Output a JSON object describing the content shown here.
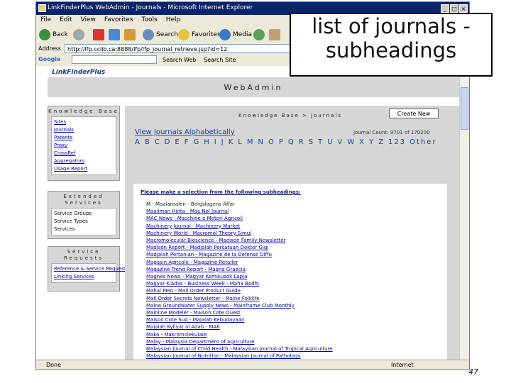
{
  "window": {
    "title": "LinkFinderPlus WebAdmin - Journals - Microsoft Internet Explorer",
    "menu": [
      "File",
      "Edit",
      "View",
      "Favorites",
      "Tools",
      "Help"
    ]
  },
  "toolbar": {
    "back": "Back",
    "search": "Search",
    "favorites": "Favorites",
    "media": "Media"
  },
  "address": {
    "label": "Address",
    "url": "http://lfp.cclib.ca:8888/lfp/lfp_journal_retrieve.jsp?id=12"
  },
  "google": {
    "logo": "Google",
    "search_web": "Search Web",
    "search_site": "Search Site"
  },
  "status": {
    "left": "Done",
    "right": "Internet"
  },
  "page": {
    "logo": "LinkFinderPlus",
    "banner": "WebAdmin",
    "breadcrumb": "Knowledge Base > Journals",
    "create_button": "Create New",
    "view_link": "View Journals Alphabetically",
    "journal_count": "Journal Count: 9701 of 170200",
    "letters": [
      "A",
      "B",
      "C",
      "D",
      "E",
      "F",
      "G",
      "H",
      "I",
      "J",
      "K",
      "L",
      "M",
      "N",
      "O",
      "P",
      "Q",
      "R",
      "S",
      "T",
      "U",
      "V",
      "W",
      "X",
      "Y",
      "Z",
      "123",
      "Other"
    ],
    "list_heading": "Please make a selection from the following subheadings:",
    "subheadings": [
      "M - Maalaroalen - Bergslagens Affar",
      "Maailman Hinta - Mac Nol Journal",
      "MAC News - Macchine e Motori Agricoli",
      "Machinery Journal - Machinery Market",
      "Machinery World - Macromol Theory Simul",
      "Macromolecular Bioscience - Madison Family Newsletter",
      "Madison Report - Madjalah Persatuan Dokter Gigi",
      "Madjalah Pertanian - Magazine de la Defense Diffu",
      "Magasin Agricole - Magazine Retailer",
      "Magazine Trend Report - Magna Graecia",
      "Magnes News - Magyar Kemikusok Lapja",
      "Magyar Kiadas - Business Week - Maha Bodhi",
      "Mahal Men - Mail Order Product Guide",
      "Mail Order Secrets Newsletter - Maine Folklife",
      "Maine Groundwater Supply News - Mainframe Club Monthly",
      "Mainline Modeler - Maison Cote Ouest",
      "Maison Cote Sud - Majalah Kebudayaan",
      "Majalah Kyllyat al Adab - MAK",
      "Mako - Makromolekulare",
      "Malay - Malaysia Department of Agriculture",
      "Malaysian Journal of Child Health - Malaysian Journal of Tropical Agriculture",
      "Malaysian Journal of Nutrition - Malaysian Journal of Pathology"
    ]
  },
  "sidebar": {
    "knowledge_base": {
      "title": "Knowledge Base",
      "items": [
        "Sites",
        "Journals",
        "Patents",
        "Proxy",
        "CrossRef",
        "Aggregators",
        "Usage Report"
      ]
    },
    "extended_services": {
      "title": "Extended Services",
      "items": [
        "Service Groups",
        "Service Types",
        "Services"
      ]
    },
    "service_requests": {
      "title": "Service Requests",
      "items": [
        "Reference & Service Requests",
        "Linking Services"
      ]
    }
  },
  "overlay": {
    "line1": "list of journals -",
    "line2": "subheadings"
  },
  "slide_number": "47"
}
